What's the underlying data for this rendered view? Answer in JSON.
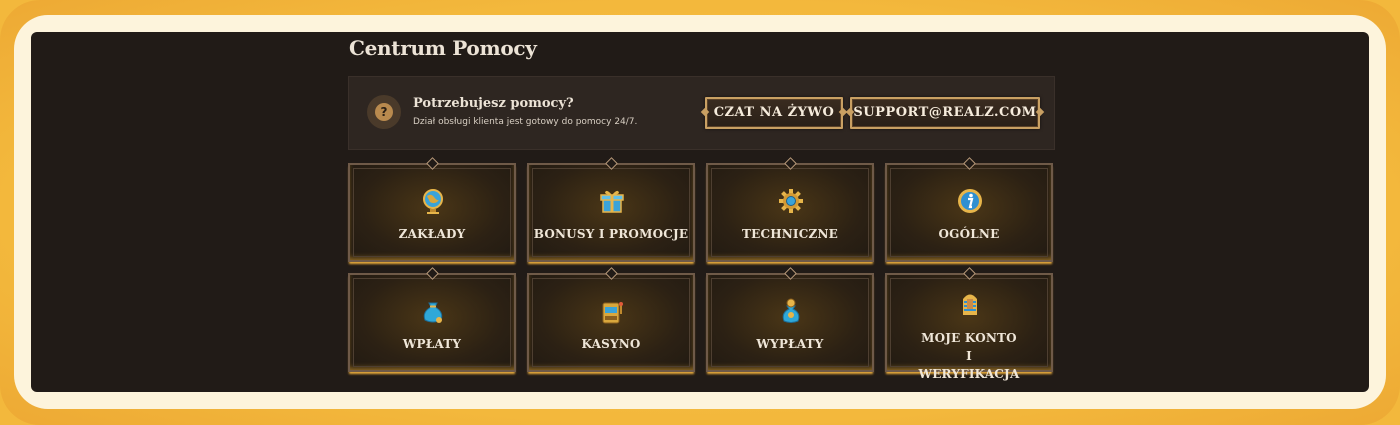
{
  "page": {
    "title": "Centrum Pomocy"
  },
  "help_banner": {
    "title": "Potrzebujesz pomocy?",
    "subtitle": "Dział obsługi klienta jest gotowy do pomocy 24/7.",
    "icon": "question-icon",
    "chat_label": "CZAT NA ŻYWO",
    "email_label": "SUPPORT@REALZ.COM"
  },
  "categories": [
    {
      "label": "ZAKŁADY",
      "icon": "globe-icon"
    },
    {
      "label": "BONUSY I PROMOCJE",
      "icon": "gift-icon"
    },
    {
      "label": "TECHNICZNE",
      "icon": "gear-icon"
    },
    {
      "label": "OGÓLNE",
      "icon": "info-icon"
    },
    {
      "label": "WPŁATY",
      "icon": "money-bag-icon"
    },
    {
      "label": "KASYNO",
      "icon": "slot-machine-icon"
    },
    {
      "label": "WYPŁATY",
      "icon": "coin-bag-icon"
    },
    {
      "label": "MOJE KONTO I WERYFIKACJA",
      "icon": "pharaoh-icon"
    }
  ]
}
